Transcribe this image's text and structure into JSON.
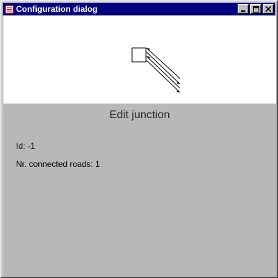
{
  "window": {
    "title": "Configuration dialog",
    "controls": {
      "minimize": "minimize",
      "maximize": "maximize",
      "close": "close"
    }
  },
  "panel": {
    "heading": "Edit junction",
    "id_label": "Id:",
    "id_value": "-1",
    "roads_label": "Nr. connected roads:",
    "roads_value": "1"
  },
  "colors": {
    "titlebar": "#000080",
    "preview_bg": "#ffffff",
    "panel_bg": "#b8b8b8"
  },
  "icons": [
    "app-icon",
    "minimize-icon",
    "maximize-icon",
    "close-icon"
  ]
}
